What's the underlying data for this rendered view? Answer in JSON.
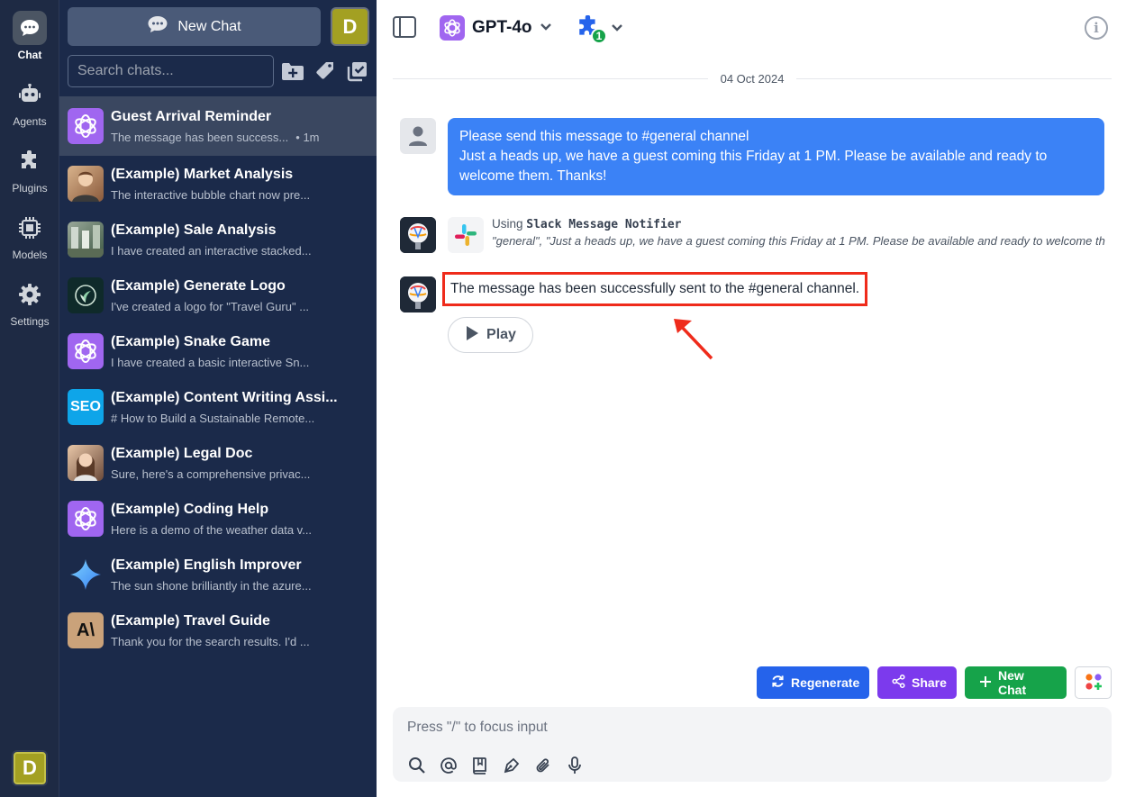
{
  "rail": {
    "items": [
      {
        "label": "Chat"
      },
      {
        "label": "Agents"
      },
      {
        "label": "Plugins"
      },
      {
        "label": "Models"
      },
      {
        "label": "Settings"
      }
    ],
    "avatar_letter": "D"
  },
  "sidebar": {
    "new_chat_label": "New Chat",
    "avatar_letter": "D",
    "search_placeholder": "Search chats...",
    "chats": [
      {
        "title": "Guest Arrival Reminder",
        "snippet": "The message has been success...",
        "time": "• 1m"
      },
      {
        "title": "(Example) Market Analysis",
        "snippet": "The interactive bubble chart now pre..."
      },
      {
        "title": "(Example) Sale Analysis",
        "snippet": "I have created an interactive stacked..."
      },
      {
        "title": "(Example) Generate Logo",
        "snippet": "I've created a logo for \"Travel Guru\" ..."
      },
      {
        "title": "(Example) Snake Game",
        "snippet": "I have created a basic interactive Sn..."
      },
      {
        "title": "(Example) Content Writing Assi...",
        "snippet": "# How to Build a Sustainable Remote...",
        "avatar_text": "SEO"
      },
      {
        "title": "(Example) Legal Doc",
        "snippet": "Sure, here's a comprehensive privac..."
      },
      {
        "title": "(Example) Coding Help",
        "snippet": "Here is a demo of the weather data v..."
      },
      {
        "title": "(Example) English Improver",
        "snippet": "The sun shone brilliantly in the azure..."
      },
      {
        "title": "(Example) Travel Guide",
        "snippet": "Thank you for the search results. I'd ...",
        "avatar_text": "A\\"
      }
    ]
  },
  "topbar": {
    "model_name": "GPT-4o",
    "plugin_count": "1",
    "info_glyph": "i"
  },
  "conversation": {
    "date": "04 Oct 2024",
    "user_message_line1": "Please send this message to #general channel",
    "user_message_line2": "Just a heads up, we have a guest coming this Friday at 1 PM. Please be available and ready to welcome them. Thanks!",
    "tool_using_prefix": "Using",
    "tool_name": "Slack Message Notifier",
    "tool_args": "\"general\", \"Just a heads up, we have a guest coming this Friday at 1 PM. Please be available and ready to welcome them. Thanks!\"",
    "assistant_message": "The message has been successfully sent to the #general channel.",
    "play_label": "Play"
  },
  "actions": {
    "regenerate_label": "Regenerate",
    "share_label": "Share",
    "new_chat_label": "New Chat"
  },
  "composer": {
    "placeholder": "Press \"/\" to focus input"
  },
  "colors": {
    "rail_bg": "#1e2a44",
    "sidebar_bg": "#1b2a4a",
    "user_bubble": "#3b82f6",
    "highlight_box": "#ef2b1b",
    "regenerate": "#2563eb",
    "share": "#7c3aed",
    "new_chat": "#16a34a"
  }
}
